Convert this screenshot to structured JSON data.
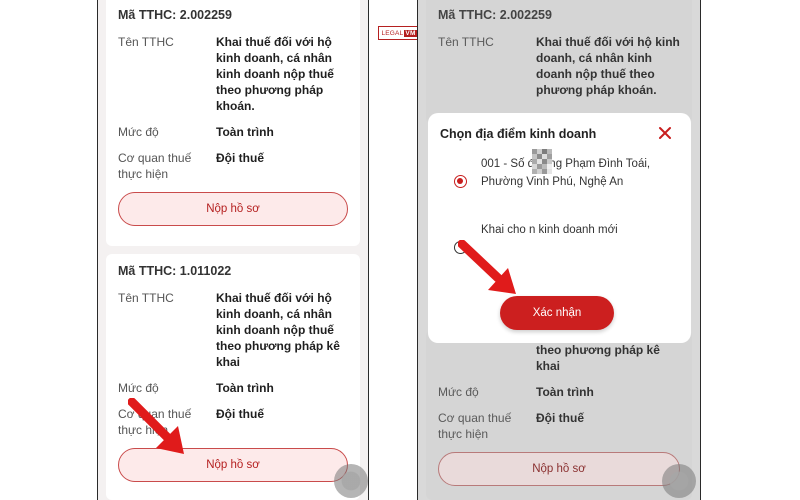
{
  "watermark": {
    "text_left": "LEGAL",
    "text_right": "VM"
  },
  "left": {
    "card1": {
      "code": "Mã TTHC: 2.002259",
      "rows": [
        {
          "label": "Tên TTHC",
          "value": "Khai thuế đối với hộ kinh doanh, cá nhân kinh doanh nộp thuế theo phương pháp khoán."
        },
        {
          "label": "Mức độ",
          "value": "Toàn trình"
        },
        {
          "label": "Cơ quan thuế thực hiện",
          "value": "Đội thuế"
        }
      ],
      "button": "Nộp hồ sơ"
    },
    "card2": {
      "code": "Mã TTHC: 1.011022",
      "rows": [
        {
          "label": "Tên TTHC",
          "value": "Khai thuế đối với hộ kinh doanh, cá nhân kinh doanh nộp thuế theo phương pháp kê khai"
        },
        {
          "label": "Mức độ",
          "value": "Toàn trình"
        },
        {
          "label": "Cơ quan thuế thực hiện",
          "value": "Đội thuế"
        }
      ],
      "button": "Nộp hồ sơ"
    }
  },
  "right": {
    "card1": {
      "code": "Mã TTHC: 2.002259",
      "label": "Tên TTHC",
      "value": "Khai thuế đối với hộ kinh doanh, cá nhân kinh doanh nộp thuế theo phương pháp khoán."
    },
    "card2": {
      "value_tail": "theo phương pháp kê khai",
      "rows": [
        {
          "label": "Mức độ",
          "value": "Toàn trình"
        },
        {
          "label": "Cơ quan thuế thực hiện",
          "value": "Đội thuế"
        }
      ],
      "button": "Nộp hồ sơ"
    },
    "modal": {
      "title": "Chọn địa điểm kinh doanh",
      "options": [
        {
          "text": "001 - Số đường Phạm Đình Toái, Phường Vinh Phú, Nghệ An",
          "selected": true
        },
        {
          "text": "Khai cho n kinh doanh mới",
          "selected": false
        }
      ],
      "confirm": "Xác nhận"
    }
  },
  "colors": {
    "accent": "#cc1f1f",
    "button_bg": "#fdeaea",
    "overlay": "#d9d9d9"
  }
}
